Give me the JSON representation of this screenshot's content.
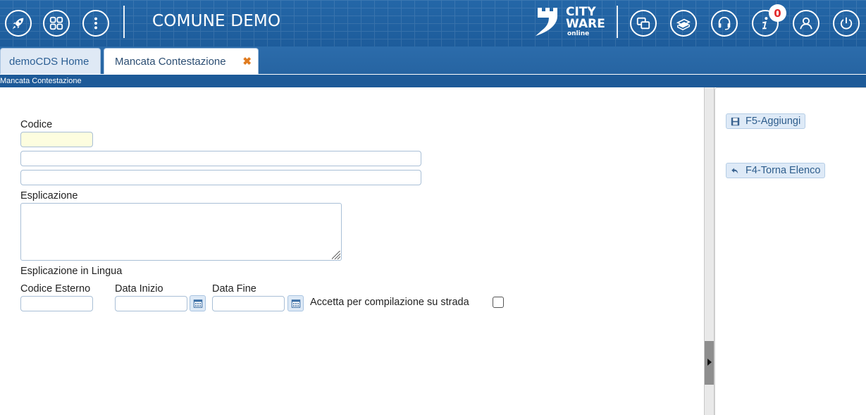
{
  "header": {
    "title": "COMUNE DEMO",
    "logo": {
      "line1": "CITY",
      "line2": "WARE",
      "line3": "online"
    },
    "notification_count": "0",
    "left_icons": [
      "rocket-icon",
      "grid-icon",
      "more-vertical-icon"
    ],
    "right_icons": [
      "windows-icon",
      "books-icon",
      "headset-icon",
      "info-icon",
      "user-icon",
      "power-icon"
    ],
    "colors": {
      "bar": "#1f5f9f",
      "badge_text": "#e3292b"
    }
  },
  "tabs": [
    {
      "label": "demoCDS Home",
      "active": false
    },
    {
      "label": "Mancata Contestazione",
      "active": true,
      "close": "✖"
    }
  ],
  "breadcrumb": "Mancata Contestazione",
  "form": {
    "codice_label": "Codice",
    "codice_value": "",
    "desc1_value": "",
    "desc2_value": "",
    "esplicazione_label": "Esplicazione",
    "esplicazione_value": "",
    "esplicazione_lingua_label": "Esplicazione in Lingua",
    "codice_esterno_label": "Codice Esterno",
    "data_inizio_label": "Data Inizio",
    "data_fine_label": "Data Fine",
    "accetta_label": "Accetta per compilazione su strada",
    "accetta_checked": false
  },
  "side": {
    "add_button": "F5-Aggiungi",
    "back_button": "F4-Torna Elenco"
  }
}
